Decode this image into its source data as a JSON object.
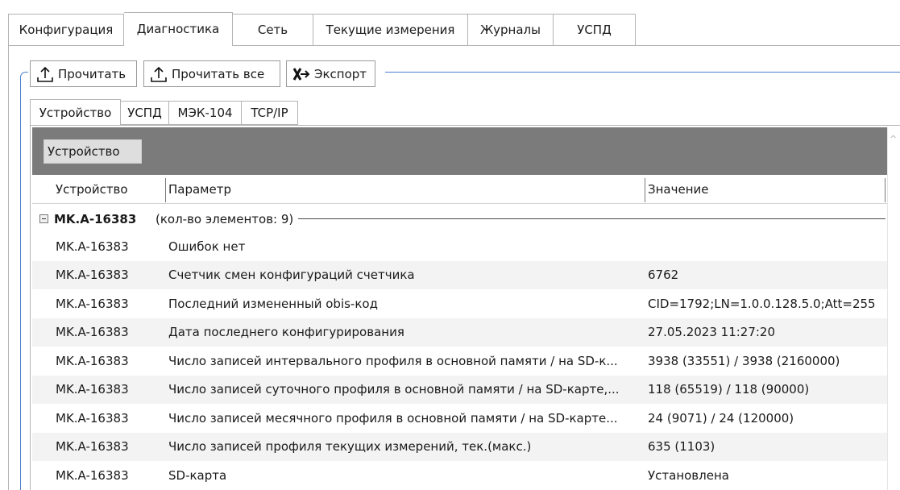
{
  "top_tabs": [
    {
      "label": "Конфигурация",
      "active": false
    },
    {
      "label": "Диагностика",
      "active": true
    },
    {
      "label": "Сеть",
      "active": false
    },
    {
      "label": "Текущие измерения",
      "active": false
    },
    {
      "label": "Журналы",
      "active": false
    },
    {
      "label": "УСПД",
      "active": false
    }
  ],
  "toolbar": {
    "read_label": "Прочитать",
    "read_all_label": "Прочитать все",
    "export_label": "Экспорт"
  },
  "inner_tabs": [
    {
      "label": "Устройство",
      "active": true
    },
    {
      "label": "УСПД",
      "active": false
    },
    {
      "label": "МЭК-104",
      "active": false
    },
    {
      "label": "TCP/IP",
      "active": false
    }
  ],
  "grid": {
    "group_by_chip": "Устройство",
    "columns": [
      "Устройство",
      "Параметр",
      "Значение"
    ],
    "group": {
      "title": "MK.A-16383",
      "count_text": "(кол-во элементов: 9)"
    },
    "rows": [
      {
        "device": "MK.A-16383",
        "param": "Ошибок нет",
        "value": ""
      },
      {
        "device": "MK.A-16383",
        "param": "Счетчик смен конфигураций счетчика",
        "value": "6762"
      },
      {
        "device": "MK.A-16383",
        "param": "Последний измененный obis-код",
        "value": "CID=1792;LN=1.0.0.128.5.0;Att=255"
      },
      {
        "device": "MK.A-16383",
        "param": "Дата последнего конфигурирования",
        "value": "27.05.2023 11:27:20"
      },
      {
        "device": "MK.A-16383",
        "param": "Число записей интервального профиля в основной памяти / на SD-к...",
        "value": "3938 (33551) / 3938 (2160000)"
      },
      {
        "device": "MK.A-16383",
        "param": "Число записей суточного профиля в основной памяти / на SD-карте,...",
        "value": "118 (65519) / 118 (90000)"
      },
      {
        "device": "MK.A-16383",
        "param": "Число записей месячного профиля в основной памяти / на SD-карте...",
        "value": "24 (9071) / 24 (120000)"
      },
      {
        "device": "MK.A-16383",
        "param": "Число записей профиля текущих измерений, тек.(макс.)",
        "value": "635 (1103)"
      },
      {
        "device": "MK.A-16383",
        "param": "SD-карта",
        "value": "Установлена"
      }
    ]
  }
}
